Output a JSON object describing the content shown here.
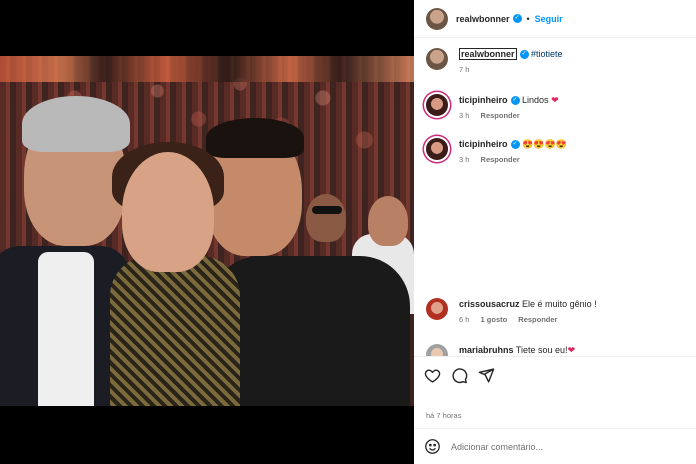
{
  "post": {
    "author": "realwbonner",
    "follow_label": "Seguir",
    "separator": "•",
    "caption_user": "realwbonner",
    "caption_text": "#tiotiete",
    "caption_time": "7 h",
    "posted": "há 7 horas"
  },
  "comments": [
    {
      "user": "ticipinheiro",
      "text": "Lindos",
      "emoji": "❤",
      "time": "3 h",
      "likes": "",
      "reply": "Responder"
    },
    {
      "user": "ticipinheiro",
      "text": "",
      "emoji": "😍😍😍😍",
      "time": "3 h",
      "likes": "",
      "reply": "Responder"
    },
    {
      "user": "crissousacruz",
      "text": "Ele é muito gênio !",
      "emoji": "",
      "time": "6 h",
      "likes": "1 gosto",
      "reply": "Responder"
    },
    {
      "user": "mariabruhns",
      "text": "Tiete sou eu!",
      "emoji": "❤",
      "time": "",
      "likes": "",
      "reply": ""
    }
  ],
  "input": {
    "placeholder": "Adicionar comentário..."
  },
  "icons": [
    "heart-icon",
    "comment-icon",
    "share-icon",
    "emoji-icon"
  ],
  "colors": {
    "accent": "#0095f6",
    "verified": "#0095f6",
    "story_ring": "#c92a7a",
    "heart": "#e0245e"
  }
}
